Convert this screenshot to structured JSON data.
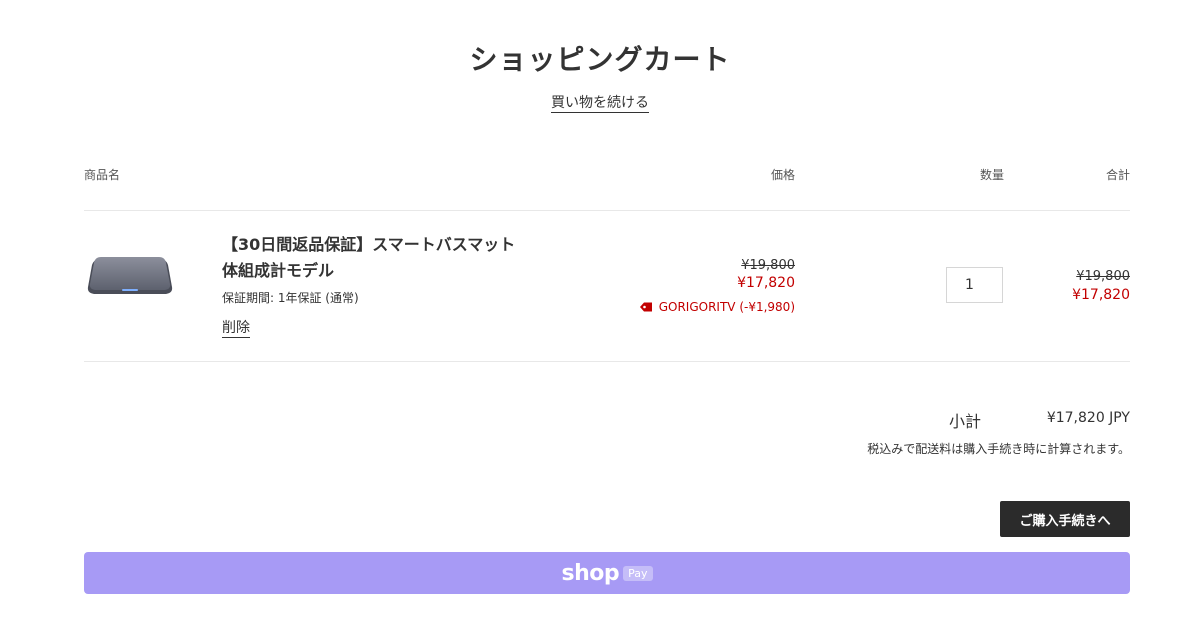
{
  "page": {
    "title": "ショッピングカート",
    "continue_shopping": "買い物を続ける"
  },
  "table": {
    "headers": {
      "product": "商品名",
      "price": "価格",
      "quantity": "数量",
      "total": "合計"
    }
  },
  "item": {
    "title_line1": "【30日間返品保証】スマートバスマット",
    "title_line2": "体組成計モデル",
    "warranty": "保証期間: 1年保証 (通常)",
    "remove_label": "削除",
    "price_original": "¥19,800",
    "price_discounted": "¥17,820",
    "discount_label": "GORIGORITV (-¥1,980)",
    "quantity": "1",
    "total_original": "¥19,800",
    "total_discounted": "¥17,820"
  },
  "summary": {
    "subtotal_label": "小計",
    "subtotal_value": "¥17,820 JPY",
    "tax_note": "税込みで配送料は購入手続き時に計算されます。",
    "checkout_label": "ご購入手続きへ"
  },
  "shop_pay": {
    "brand": "shop",
    "badge": "Pay"
  },
  "colors": {
    "sale_red": "#c20000",
    "checkout_bg": "#2b2b2b",
    "shop_pay_bg": "#a79af5"
  }
}
